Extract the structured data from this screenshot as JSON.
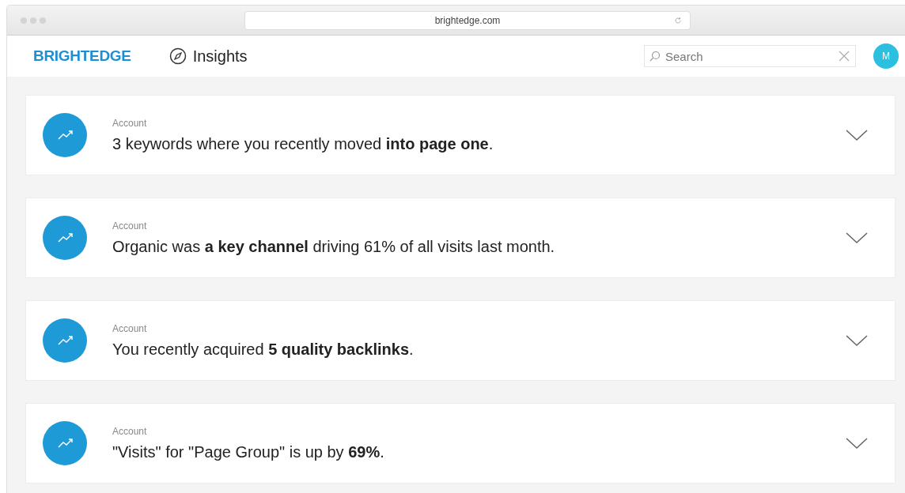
{
  "browser": {
    "url": "brightedge.com"
  },
  "header": {
    "logo": "BRIGHTEDGE",
    "section": "Insights",
    "search": {
      "placeholder": "Search"
    },
    "avatar": "M"
  },
  "insights": [
    {
      "category": "Account",
      "text": "3 keywords where you recently moved **into page one**."
    },
    {
      "category": "Account",
      "text": "Organic was **a key channel** driving 61% of all visits last month."
    },
    {
      "category": "Account",
      "text": "You recently acquired **5 quality backlinks**."
    },
    {
      "category": "Account",
      "text": "\"Visits\" for \"Page Group\" is up by **69%**."
    }
  ]
}
